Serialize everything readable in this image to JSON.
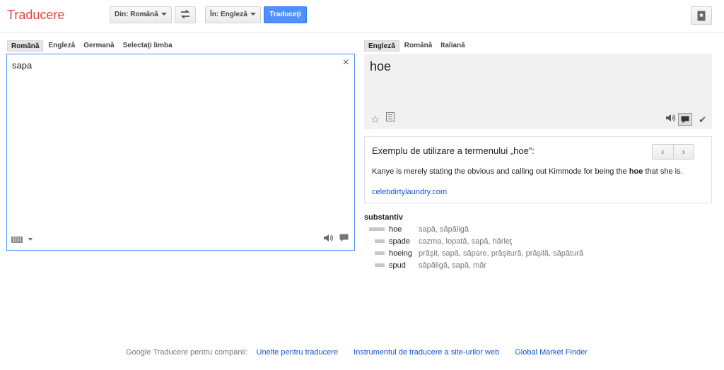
{
  "header": {
    "title": "Traducere",
    "from_label": "Din: Română",
    "to_label": "În: Engleză",
    "translate_label": "Traduceţi"
  },
  "source": {
    "tabs": [
      {
        "label": "Română",
        "active": true
      },
      {
        "label": "Engleză"
      },
      {
        "label": "Germană"
      },
      {
        "label": "Selectaţi limba"
      }
    ],
    "text": "sapa",
    "clear_label": "×"
  },
  "result": {
    "tabs": [
      {
        "label": "Engleză",
        "active": true
      },
      {
        "label": "Română"
      },
      {
        "label": "Italiană"
      }
    ],
    "text": "hoe"
  },
  "example": {
    "title": "Exemplu de utilizare a termenului „hoe”:",
    "sentence_before": "Kanye is merely stating the obvious and calling out Kimmode for being the ",
    "sentence_bold": "hoe",
    "sentence_after": " that she is.",
    "source": "celebdirtylaundry.com"
  },
  "dictionary": {
    "pos": "substantiv",
    "entries": [
      {
        "word": "hoe",
        "translations": "sapă, săpăligă"
      },
      {
        "word": "spade",
        "translations": "cazma, lopată, sapă, hârleţ"
      },
      {
        "word": "hoeing",
        "translations": "prăşit, sapă, săpare, prăşitură, prăşilă, săpătură"
      },
      {
        "word": "spud",
        "translations": "săpăligă, sapă, măr"
      }
    ]
  },
  "footer": {
    "label": "Google Traducere pentru companii:",
    "links": [
      "Unelte pentru traducere",
      "Instrumentul de traducere a site-urilor web",
      "Global Market Finder"
    ]
  },
  "colors": {
    "brand": "#dd4b39",
    "accent": "#4d90fe",
    "link": "#1155cc"
  }
}
